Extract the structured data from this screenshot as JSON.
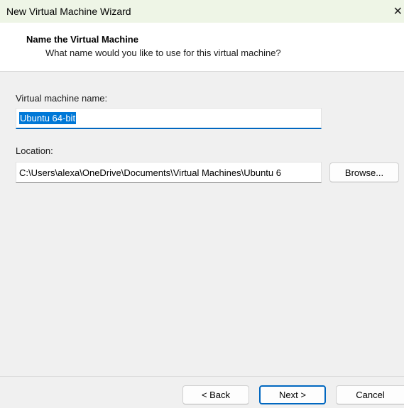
{
  "window": {
    "title": "New Virtual Machine Wizard",
    "close_glyph": "✕"
  },
  "header": {
    "title": "Name the Virtual Machine",
    "subtitle": "What name would you like to use for this virtual machine?"
  },
  "form": {
    "name_label": "Virtual machine name:",
    "name_value": "Ubuntu 64-bit",
    "location_label": "Location:",
    "location_value": "C:\\Users\\alexa\\OneDrive\\Documents\\Virtual Machines\\Ubuntu 6",
    "browse_label": "Browse..."
  },
  "footer": {
    "back_label": "< Back",
    "next_label": "Next >",
    "cancel_label": "Cancel"
  },
  "colors": {
    "titlebar_bg": "#eef5e6",
    "accent": "#0067c0",
    "selection": "#0078d7"
  },
  "icons": {
    "close": "close-icon"
  }
}
